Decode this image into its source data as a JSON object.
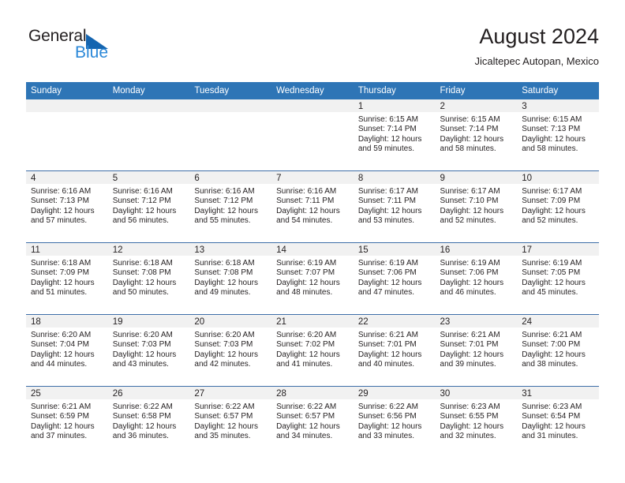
{
  "brand": {
    "name_part1": "General",
    "name_part2": "Blue",
    "triangle_color": "#1565b0",
    "blue_text_color": "#2b88d8"
  },
  "header": {
    "title": "August 2024",
    "subtitle": "Jicaltepec Autopan, Mexico"
  },
  "theme": {
    "header_bg": "#2e75b6",
    "header_text": "#ffffff",
    "row_border": "#3e6ea8",
    "daynum_band_bg": "#f1f1f1",
    "body_text": "#231f20"
  },
  "weekdays": [
    "Sunday",
    "Monday",
    "Tuesday",
    "Wednesday",
    "Thursday",
    "Friday",
    "Saturday"
  ],
  "weeks": [
    [
      {
        "day": "",
        "empty": true
      },
      {
        "day": "",
        "empty": true
      },
      {
        "day": "",
        "empty": true
      },
      {
        "day": "",
        "empty": true
      },
      {
        "day": "1",
        "sunrise": "Sunrise: 6:15 AM",
        "sunset": "Sunset: 7:14 PM",
        "daylight1": "Daylight: 12 hours",
        "daylight2": "and 59 minutes."
      },
      {
        "day": "2",
        "sunrise": "Sunrise: 6:15 AM",
        "sunset": "Sunset: 7:14 PM",
        "daylight1": "Daylight: 12 hours",
        "daylight2": "and 58 minutes."
      },
      {
        "day": "3",
        "sunrise": "Sunrise: 6:15 AM",
        "sunset": "Sunset: 7:13 PM",
        "daylight1": "Daylight: 12 hours",
        "daylight2": "and 58 minutes."
      }
    ],
    [
      {
        "day": "4",
        "sunrise": "Sunrise: 6:16 AM",
        "sunset": "Sunset: 7:13 PM",
        "daylight1": "Daylight: 12 hours",
        "daylight2": "and 57 minutes."
      },
      {
        "day": "5",
        "sunrise": "Sunrise: 6:16 AM",
        "sunset": "Sunset: 7:12 PM",
        "daylight1": "Daylight: 12 hours",
        "daylight2": "and 56 minutes."
      },
      {
        "day": "6",
        "sunrise": "Sunrise: 6:16 AM",
        "sunset": "Sunset: 7:12 PM",
        "daylight1": "Daylight: 12 hours",
        "daylight2": "and 55 minutes."
      },
      {
        "day": "7",
        "sunrise": "Sunrise: 6:16 AM",
        "sunset": "Sunset: 7:11 PM",
        "daylight1": "Daylight: 12 hours",
        "daylight2": "and 54 minutes."
      },
      {
        "day": "8",
        "sunrise": "Sunrise: 6:17 AM",
        "sunset": "Sunset: 7:11 PM",
        "daylight1": "Daylight: 12 hours",
        "daylight2": "and 53 minutes."
      },
      {
        "day": "9",
        "sunrise": "Sunrise: 6:17 AM",
        "sunset": "Sunset: 7:10 PM",
        "daylight1": "Daylight: 12 hours",
        "daylight2": "and 52 minutes."
      },
      {
        "day": "10",
        "sunrise": "Sunrise: 6:17 AM",
        "sunset": "Sunset: 7:09 PM",
        "daylight1": "Daylight: 12 hours",
        "daylight2": "and 52 minutes."
      }
    ],
    [
      {
        "day": "11",
        "sunrise": "Sunrise: 6:18 AM",
        "sunset": "Sunset: 7:09 PM",
        "daylight1": "Daylight: 12 hours",
        "daylight2": "and 51 minutes."
      },
      {
        "day": "12",
        "sunrise": "Sunrise: 6:18 AM",
        "sunset": "Sunset: 7:08 PM",
        "daylight1": "Daylight: 12 hours",
        "daylight2": "and 50 minutes."
      },
      {
        "day": "13",
        "sunrise": "Sunrise: 6:18 AM",
        "sunset": "Sunset: 7:08 PM",
        "daylight1": "Daylight: 12 hours",
        "daylight2": "and 49 minutes."
      },
      {
        "day": "14",
        "sunrise": "Sunrise: 6:19 AM",
        "sunset": "Sunset: 7:07 PM",
        "daylight1": "Daylight: 12 hours",
        "daylight2": "and 48 minutes."
      },
      {
        "day": "15",
        "sunrise": "Sunrise: 6:19 AM",
        "sunset": "Sunset: 7:06 PM",
        "daylight1": "Daylight: 12 hours",
        "daylight2": "and 47 minutes."
      },
      {
        "day": "16",
        "sunrise": "Sunrise: 6:19 AM",
        "sunset": "Sunset: 7:06 PM",
        "daylight1": "Daylight: 12 hours",
        "daylight2": "and 46 minutes."
      },
      {
        "day": "17",
        "sunrise": "Sunrise: 6:19 AM",
        "sunset": "Sunset: 7:05 PM",
        "daylight1": "Daylight: 12 hours",
        "daylight2": "and 45 minutes."
      }
    ],
    [
      {
        "day": "18",
        "sunrise": "Sunrise: 6:20 AM",
        "sunset": "Sunset: 7:04 PM",
        "daylight1": "Daylight: 12 hours",
        "daylight2": "and 44 minutes."
      },
      {
        "day": "19",
        "sunrise": "Sunrise: 6:20 AM",
        "sunset": "Sunset: 7:03 PM",
        "daylight1": "Daylight: 12 hours",
        "daylight2": "and 43 minutes."
      },
      {
        "day": "20",
        "sunrise": "Sunrise: 6:20 AM",
        "sunset": "Sunset: 7:03 PM",
        "daylight1": "Daylight: 12 hours",
        "daylight2": "and 42 minutes."
      },
      {
        "day": "21",
        "sunrise": "Sunrise: 6:20 AM",
        "sunset": "Sunset: 7:02 PM",
        "daylight1": "Daylight: 12 hours",
        "daylight2": "and 41 minutes."
      },
      {
        "day": "22",
        "sunrise": "Sunrise: 6:21 AM",
        "sunset": "Sunset: 7:01 PM",
        "daylight1": "Daylight: 12 hours",
        "daylight2": "and 40 minutes."
      },
      {
        "day": "23",
        "sunrise": "Sunrise: 6:21 AM",
        "sunset": "Sunset: 7:01 PM",
        "daylight1": "Daylight: 12 hours",
        "daylight2": "and 39 minutes."
      },
      {
        "day": "24",
        "sunrise": "Sunrise: 6:21 AM",
        "sunset": "Sunset: 7:00 PM",
        "daylight1": "Daylight: 12 hours",
        "daylight2": "and 38 minutes."
      }
    ],
    [
      {
        "day": "25",
        "sunrise": "Sunrise: 6:21 AM",
        "sunset": "Sunset: 6:59 PM",
        "daylight1": "Daylight: 12 hours",
        "daylight2": "and 37 minutes."
      },
      {
        "day": "26",
        "sunrise": "Sunrise: 6:22 AM",
        "sunset": "Sunset: 6:58 PM",
        "daylight1": "Daylight: 12 hours",
        "daylight2": "and 36 minutes."
      },
      {
        "day": "27",
        "sunrise": "Sunrise: 6:22 AM",
        "sunset": "Sunset: 6:57 PM",
        "daylight1": "Daylight: 12 hours",
        "daylight2": "and 35 minutes."
      },
      {
        "day": "28",
        "sunrise": "Sunrise: 6:22 AM",
        "sunset": "Sunset: 6:57 PM",
        "daylight1": "Daylight: 12 hours",
        "daylight2": "and 34 minutes."
      },
      {
        "day": "29",
        "sunrise": "Sunrise: 6:22 AM",
        "sunset": "Sunset: 6:56 PM",
        "daylight1": "Daylight: 12 hours",
        "daylight2": "and 33 minutes."
      },
      {
        "day": "30",
        "sunrise": "Sunrise: 6:23 AM",
        "sunset": "Sunset: 6:55 PM",
        "daylight1": "Daylight: 12 hours",
        "daylight2": "and 32 minutes."
      },
      {
        "day": "31",
        "sunrise": "Sunrise: 6:23 AM",
        "sunset": "Sunset: 6:54 PM",
        "daylight1": "Daylight: 12 hours",
        "daylight2": "and 31 minutes."
      }
    ]
  ]
}
